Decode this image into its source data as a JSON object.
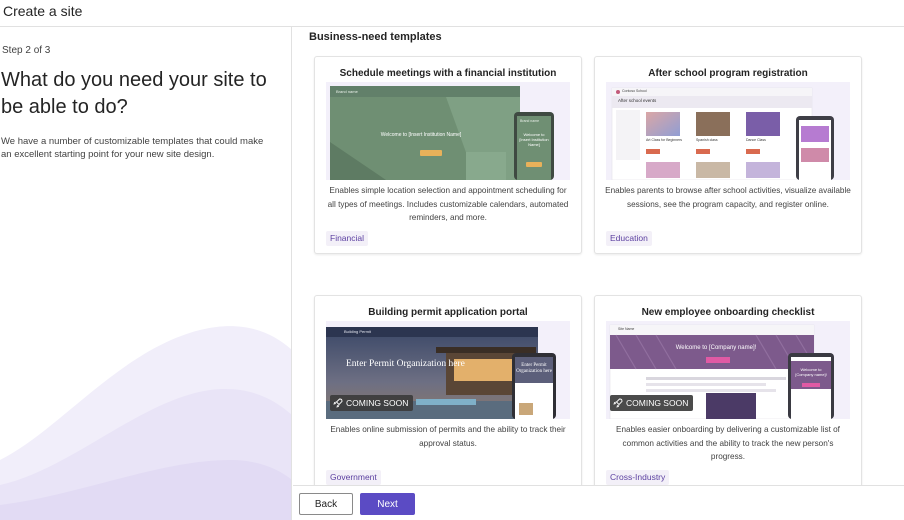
{
  "window": {
    "title": "Create a site"
  },
  "sidebar": {
    "step": "Step 2 of 3",
    "heading": "What do you need your site to be able to do?",
    "description": "We have a number of customizable templates that could make an excellent starting point for your new site design."
  },
  "main": {
    "section_title": "Business-need templates",
    "cards": [
      {
        "title": "Schedule meetings with a financial institution",
        "description": "Enables simple location selection and appointment scheduling for all types of meetings. Includes customizable calendars, automated reminders, and more.",
        "tag": "Financial",
        "preview": {
          "site_name": "Brand name",
          "hero": "Welcome to [Insert Institution Name]",
          "mobile_hero": "Welcome to [Insert Institution Name]",
          "mobile_brand": "Brand name"
        }
      },
      {
        "title": "After school program registration",
        "description": "Enables parents to browse after school activities, visualize available sessions, see the program capacity, and register online.",
        "tag": "Education",
        "preview": {
          "site_name": "Contoso School",
          "heading": "After school events",
          "cards": [
            "Art Class for Beginners",
            "Spanish class",
            "Dance Class"
          ]
        }
      },
      {
        "title": "Building permit application portal",
        "description": "Enables online submission of permits and the ability to track their approval status.",
        "tag": "Government",
        "badge": "COMING SOON",
        "preview": {
          "site_name": "Building Permit",
          "hero": "Enter Permit Organization here",
          "mobile_hero": "Enter Permit Organization here"
        }
      },
      {
        "title": "New employee onboarding checklist",
        "description": "Enables easier onboarding by delivering a customizable list of common activities and the ability to track the new person's progress.",
        "tag": "Cross-Industry",
        "badge": "COMING SOON",
        "preview": {
          "site_name": "Site Name",
          "hero": "Welcome to [Company name]!",
          "mobile_hero": "Welcome to [Company name]!"
        }
      }
    ]
  },
  "footer": {
    "back_label": "Back",
    "next_label": "Next"
  },
  "colors": {
    "accent": "#5b4bc4",
    "tag_bg": "#f3f0f8",
    "tag_text": "#5b3fa0"
  }
}
